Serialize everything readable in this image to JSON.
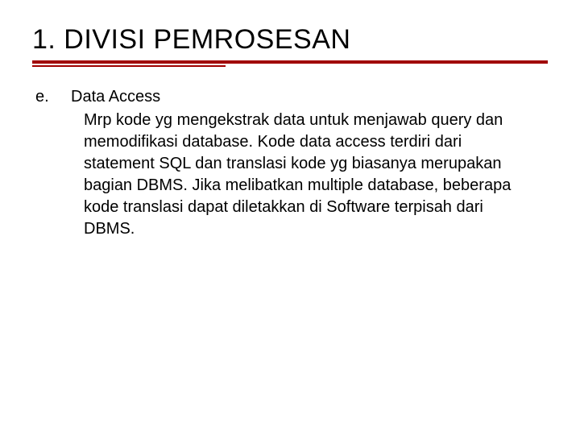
{
  "title": "1. DIVISI PEMROSESAN",
  "item": {
    "marker": "e.",
    "heading": "Data Access",
    "text": "Mrp kode yg mengekstrak data untuk menjawab query dan memodifikasi database. Kode data access terdiri dari statement SQL dan translasi kode yg biasanya merupakan bagian DBMS. Jika melibatkan multiple database, beberapa kode translasi dapat diletakkan di Software terpisah dari DBMS."
  }
}
